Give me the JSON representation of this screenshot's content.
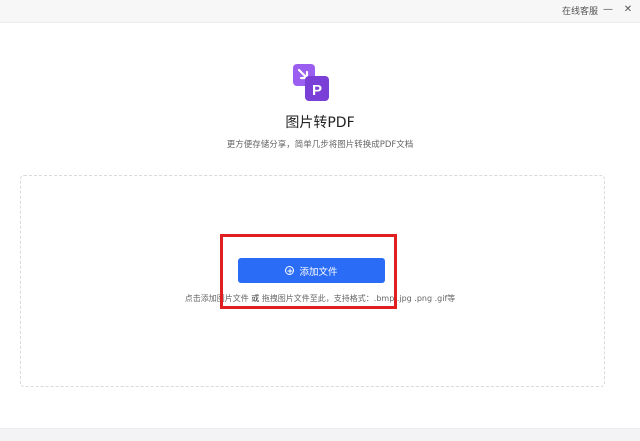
{
  "titlebar": {
    "support_label": "在线客服",
    "minimize_glyph": "—",
    "close_glyph": "✕"
  },
  "hero": {
    "icon": "image-to-pdf-icon",
    "icon_letter": "P",
    "title": "图片转PDF",
    "subtitle": "更方便存储分享，简单几步将图片转换成PDF文档"
  },
  "dropzone": {
    "add_button_label": "添加文件",
    "hint_prefix": "点击添加图片文件",
    "hint_or": "或",
    "hint_suffix": "拖拽图片文件至此，支持格式：.bmp .jpg .png .gif等"
  },
  "colors": {
    "accent": "#2a6cf5",
    "highlight": "#e02020",
    "icon_purple": "#8b4ee0"
  }
}
